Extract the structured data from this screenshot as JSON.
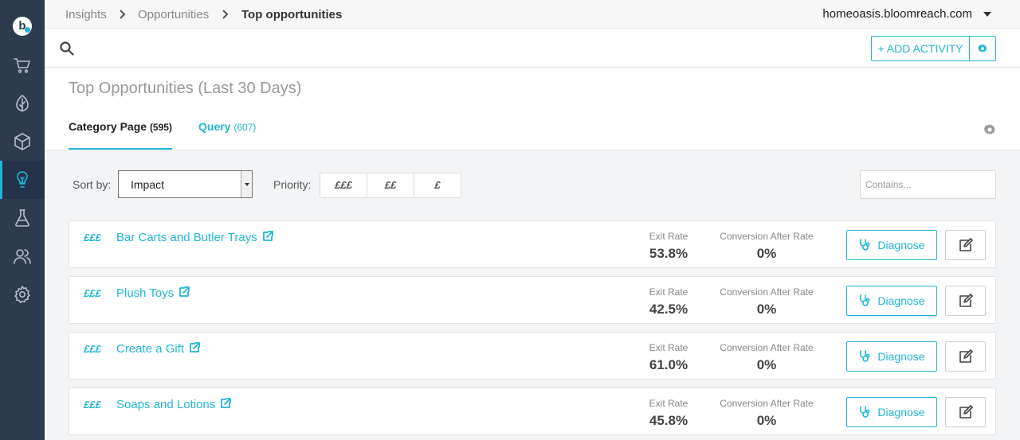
{
  "sidebar": {
    "logo": "b",
    "items": [
      {
        "icon": "cart-icon",
        "label": "Commerce"
      },
      {
        "icon": "leaf-icon",
        "label": "Organic"
      },
      {
        "icon": "cube-icon",
        "label": "Products"
      },
      {
        "icon": "lightbulb-icon",
        "label": "Insights",
        "active": true
      },
      {
        "icon": "flask-icon",
        "label": "Experiments"
      },
      {
        "icon": "users-icon",
        "label": "Users"
      },
      {
        "icon": "gear-icon",
        "label": "Settings"
      }
    ],
    "colors": {
      "background": "#2e3b4e",
      "accent": "#21b6d7"
    }
  },
  "breadcrumb": {
    "items": [
      "Insights",
      "Opportunities",
      "Top opportunities"
    ]
  },
  "domain": "homeoasis.bloomreach.com",
  "toolbar": {
    "add_activity_label": "+ ADD ACTIVITY"
  },
  "page_title": "Top Opportunities (Last 30 Days)",
  "tabs": [
    {
      "label": "Category Page",
      "count": "(595)",
      "active": true
    },
    {
      "label": "Query",
      "count": "(607)",
      "active": false
    }
  ],
  "filters": {
    "sort_label": "Sort by:",
    "sort_value": "Impact",
    "priority_label": "Priority:",
    "priority_options": [
      "£££",
      "££",
      "£"
    ],
    "contains_placeholder": "Contains..."
  },
  "rows": [
    {
      "priority": "£££",
      "name": "Bar Carts and Butler Trays",
      "exit_rate_label": "Exit Rate",
      "exit_rate": "53.8%",
      "conversion_label": "Conversion After Rate",
      "conversion": "0%",
      "diagnose_label": "Diagnose"
    },
    {
      "priority": "£££",
      "name": "Plush Toys",
      "exit_rate_label": "Exit Rate",
      "exit_rate": "42.5%",
      "conversion_label": "Conversion After Rate",
      "conversion": "0%",
      "diagnose_label": "Diagnose"
    },
    {
      "priority": "£££",
      "name": "Create a Gift",
      "exit_rate_label": "Exit Rate",
      "exit_rate": "61.0%",
      "conversion_label": "Conversion After Rate",
      "conversion": "0%",
      "diagnose_label": "Diagnose"
    },
    {
      "priority": "£££",
      "name": "Soaps and Lotions",
      "exit_rate_label": "Exit Rate",
      "exit_rate": "45.8%",
      "conversion_label": "Conversion After Rate",
      "conversion": "0%",
      "diagnose_label": "Diagnose"
    }
  ]
}
